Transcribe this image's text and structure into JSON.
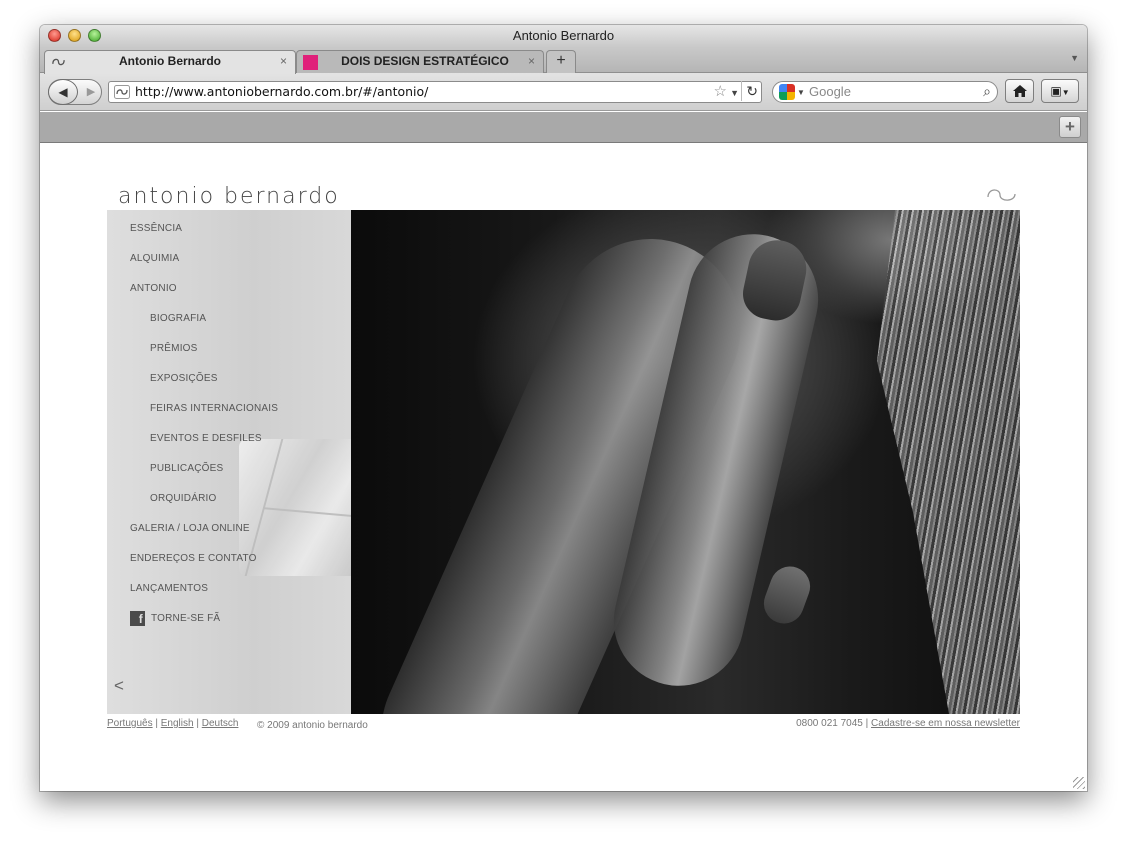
{
  "window": {
    "title": "Antonio Bernardo"
  },
  "tabs": [
    {
      "label": "Antonio Bernardo",
      "close": "×"
    },
    {
      "label": "DOIS DESIGN ESTRATÉGICO",
      "close": "×"
    }
  ],
  "newtab_label": "+",
  "nav": {
    "url": "http://www.antoniobernardo.com.br/#/antonio/",
    "search_placeholder": "Google"
  },
  "toolbar": {
    "add_label": "+"
  },
  "site": {
    "logo_text": "antonio bernardo",
    "menu": [
      {
        "label": "ESSÊNCIA",
        "level": 1
      },
      {
        "label": "ALQUIMIA",
        "level": 1
      },
      {
        "label": "ANTONIO",
        "level": 1
      },
      {
        "label": "BIOGRAFIA",
        "level": 2
      },
      {
        "label": "PRÊMIOS",
        "level": 2
      },
      {
        "label": "EXPOSIÇÕES",
        "level": 2
      },
      {
        "label": "FEIRAS INTERNACIONAIS",
        "level": 2
      },
      {
        "label": "EVENTOS E DESFILES",
        "level": 2
      },
      {
        "label": "PUBLICAÇÕES",
        "level": 2
      },
      {
        "label": "ORQUIDÁRIO",
        "level": 2
      },
      {
        "label": "GALERIA / LOJA ONLINE",
        "level": 1
      },
      {
        "label": "ENDEREÇOS E CONTATO",
        "level": 1
      },
      {
        "label": "LANÇAMENTOS",
        "level": 1
      },
      {
        "label": "TORNE-SE FÃ",
        "level": 1
      }
    ],
    "collapse_label": "<",
    "footer": {
      "lang_pt": "Português",
      "lang_en": "English",
      "lang_de": "Deutsch",
      "separator": "|",
      "copyright": "© 2009 antonio bernardo",
      "phone": "0800 021 7045",
      "newsletter": "Cadastre-se em nossa newsletter"
    }
  },
  "colors": {
    "tab2_favicon": "#e0207a"
  }
}
